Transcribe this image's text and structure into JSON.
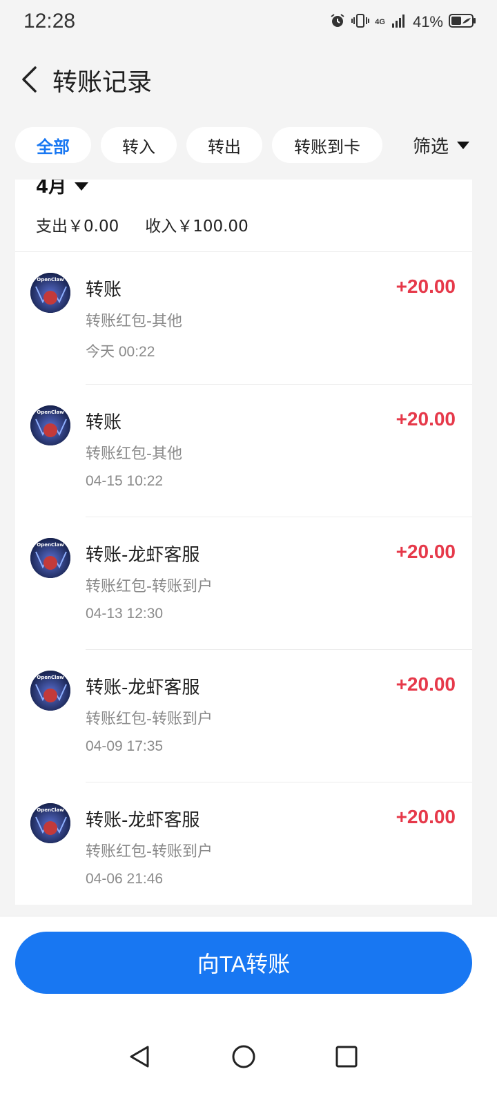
{
  "status_bar": {
    "time": "12:28",
    "battery_percent": "41%",
    "network": "4G"
  },
  "header": {
    "title": "转账记录"
  },
  "tabs": [
    {
      "label": "全部",
      "active": true
    },
    {
      "label": "转入",
      "active": false
    },
    {
      "label": "转出",
      "active": false
    },
    {
      "label": "转账到卡",
      "active": false
    }
  ],
  "filter_label": "筛选",
  "month": {
    "label": "4月"
  },
  "summary": {
    "expense": "支出￥0.00",
    "income": "收入￥100.00"
  },
  "records": [
    {
      "title": "转账",
      "subtitle": "转账红包-其他",
      "time": "今天 00:22",
      "amount": "+20.00"
    },
    {
      "title": "转账",
      "subtitle": "转账红包-其他",
      "time": "04-15 10:22",
      "amount": "+20.00"
    },
    {
      "title": "转账-龙虾客服",
      "subtitle": "转账红包-转账到户",
      "time": "04-13 12:30",
      "amount": "+20.00"
    },
    {
      "title": "转账-龙虾客服",
      "subtitle": "转账红包-转账到户",
      "time": "04-09 17:35",
      "amount": "+20.00"
    },
    {
      "title": "转账-龙虾客服",
      "subtitle": "转账红包-转账到户",
      "time": "04-06 21:46",
      "amount": "+20.00"
    }
  ],
  "avatar_text": "OpenClaw",
  "bottom_button": {
    "label": "向TA转账"
  },
  "colors": {
    "accent": "#1877f2",
    "amount_positive": "#e6394a",
    "background": "#f4f4f4"
  }
}
